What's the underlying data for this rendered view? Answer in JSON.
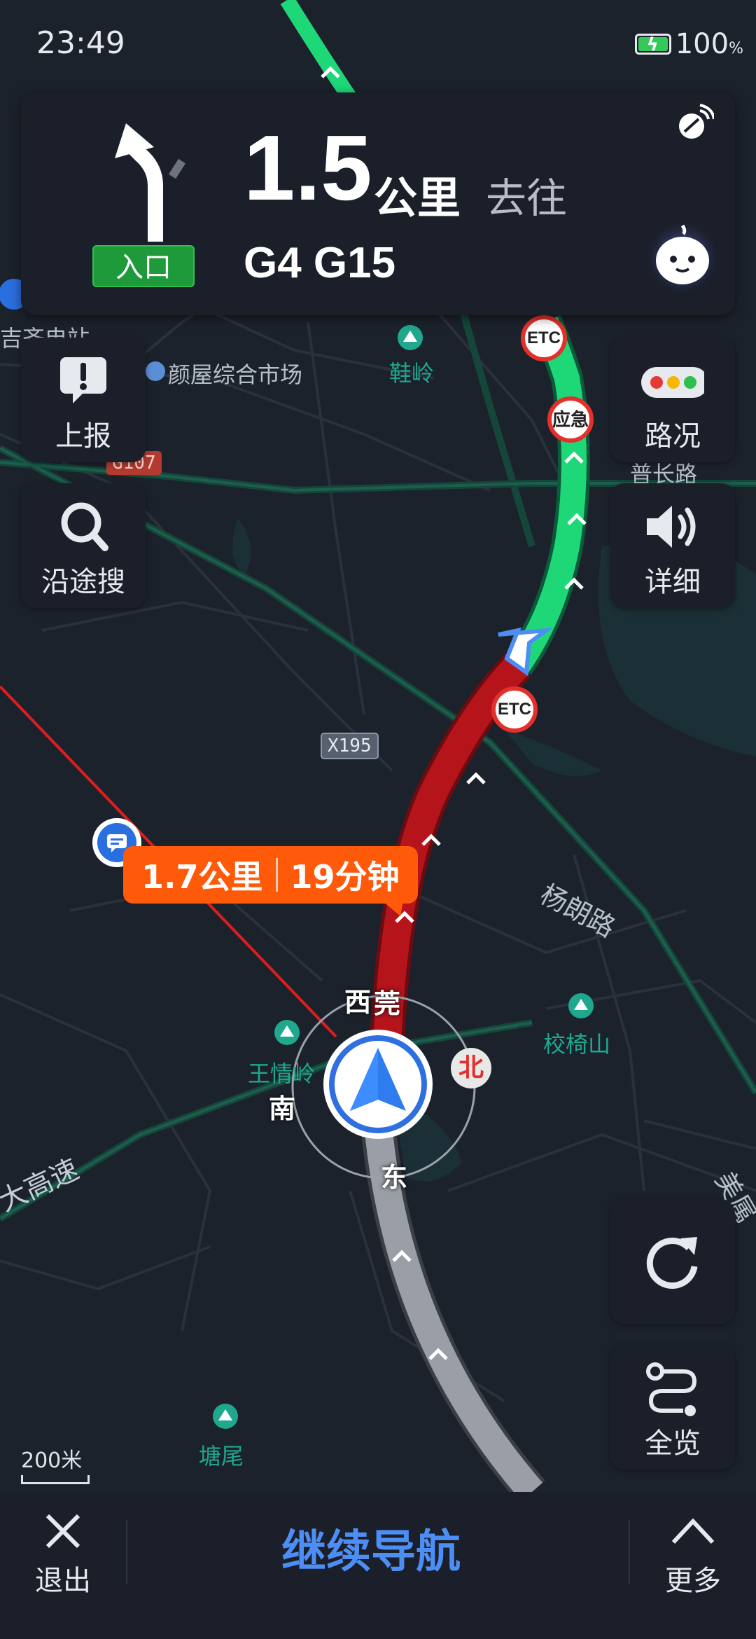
{
  "status": {
    "time": "23:49",
    "battery_pct": "100",
    "battery_unit": "%"
  },
  "guidance": {
    "distance_value": "1.5",
    "distance_unit": "公里",
    "toward": "去往",
    "road_name": "G4 G15",
    "maneuver_badge": "入口"
  },
  "side_buttons": {
    "report": "上报",
    "search_along": "沿途搜",
    "traffic": "路况",
    "detail": "详细",
    "overview": "全览"
  },
  "route_tag": {
    "distance": "1.7公里",
    "time": "19分钟"
  },
  "map": {
    "labels": {
      "station_partial": "吉齐电站",
      "market": "颜屋综合市场",
      "xieling": "鞋岭",
      "road_changlu": "普长路",
      "yanglang": "杨朗路",
      "xiaoyi": "校椅山",
      "wangqingling": "王情岭",
      "tangwei": "塘尾",
      "expressway": "大高速",
      "right_road_partial": "美属"
    },
    "shields": {
      "g107": "G107",
      "x195": "X195"
    },
    "etc_label": "ETC",
    "emergency_label": "应急",
    "compass": {
      "west": "西",
      "south": "南",
      "east": "东",
      "north": "北",
      "road_partial": "莞"
    },
    "scale": "200米"
  },
  "bottom_bar": {
    "exit": "退出",
    "continue": "继续导航",
    "more": "更多"
  },
  "colors": {
    "route_green": "#1ed878",
    "route_red": "#b5141b",
    "route_gray": "#9a9ea6",
    "accent_blue": "#4d8ef5",
    "tag_orange": "#ff5a0a"
  }
}
